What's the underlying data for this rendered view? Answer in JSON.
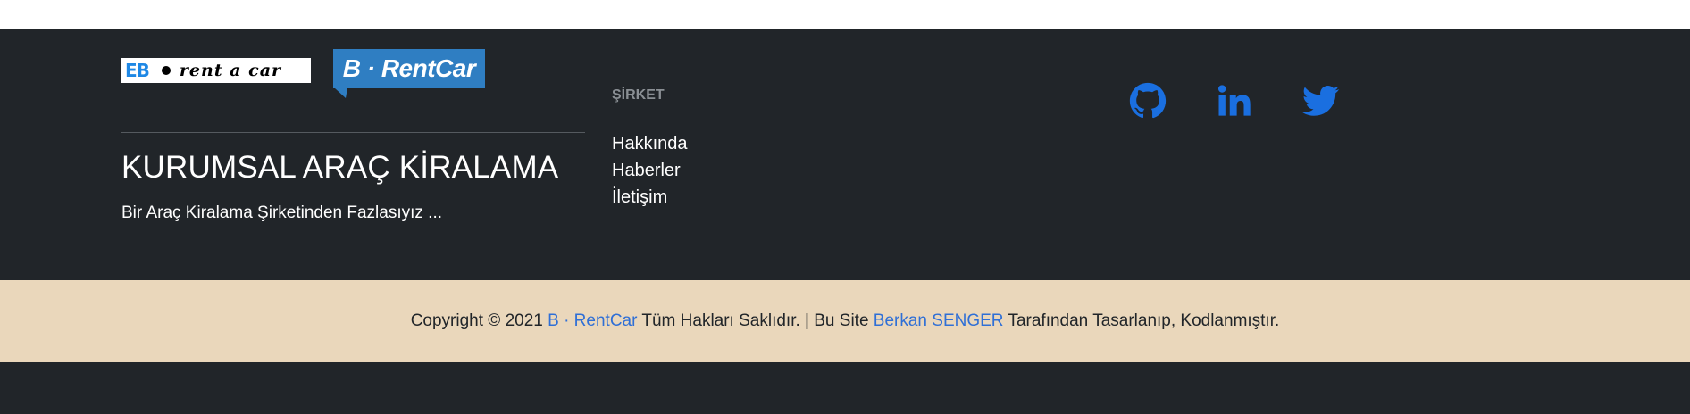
{
  "brand": {
    "logo_eb_mark": "EB",
    "logo_eb_text": "rent a car",
    "logo_b_text": "B · RentCar",
    "title": "KURUMSAL ARAÇ KİRALAMA",
    "description": "Bir Araç Kiralama Şirketinden Fazlasıyız ..."
  },
  "company": {
    "heading": "ŞİRKET",
    "links": [
      {
        "label": "Hakkında"
      },
      {
        "label": "Haberler"
      },
      {
        "label": "İletişim"
      }
    ]
  },
  "social": {
    "icons": [
      "github-icon",
      "linkedin-icon",
      "twitter-icon"
    ],
    "color": "#1a6fe0"
  },
  "copyright": {
    "prefix": "Copyright © 2021 ",
    "brand_link": "B · RentCar",
    "middle": " Tüm Hakları Saklıdır. | Bu Site ",
    "author_link": "Berkan SENGER",
    "suffix": " Tarafından Tasarlanıp, Kodlanmıştır."
  },
  "colors": {
    "footer_bg": "#212529",
    "bottom_bar_bg": "#ead7bb",
    "link": "#2f6fd6",
    "logo_blue": "#2f7ec2"
  }
}
